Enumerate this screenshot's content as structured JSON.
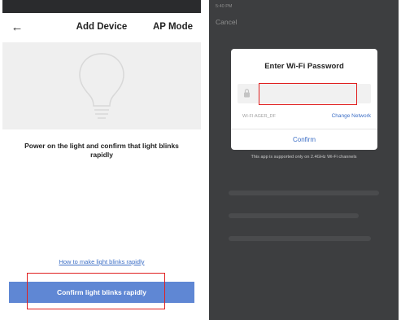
{
  "left_screen": {
    "header": {
      "title": "Add Device",
      "right_action": "AP Mode",
      "back_icon": "arrow-left-icon"
    },
    "illustration_icon": "light-bulb-icon",
    "instruction": "Power on the light and confirm that light blinks  rapidly",
    "help_link": "How to make light blinks rapidly",
    "confirm_button": "Confirm light blinks rapidly"
  },
  "right_screen": {
    "status_time": "5:40 PM",
    "cancel": "Cancel",
    "dialog": {
      "title": "Enter Wi-Fi Password",
      "password_value": "",
      "lock_icon": "lock-icon",
      "ssid": "WI-FI:AGER_DF",
      "change_network": "Change Network",
      "confirm": "Confirm"
    },
    "note": "This app is supported only on 2.4GHz Wi-Fi channels"
  },
  "colors": {
    "accent_blue": "#5f87d4",
    "link_blue": "#3d6fc6",
    "highlight_red": "#e02020",
    "dark_background": "#3d3e40",
    "hero_gray": "#efefef"
  }
}
